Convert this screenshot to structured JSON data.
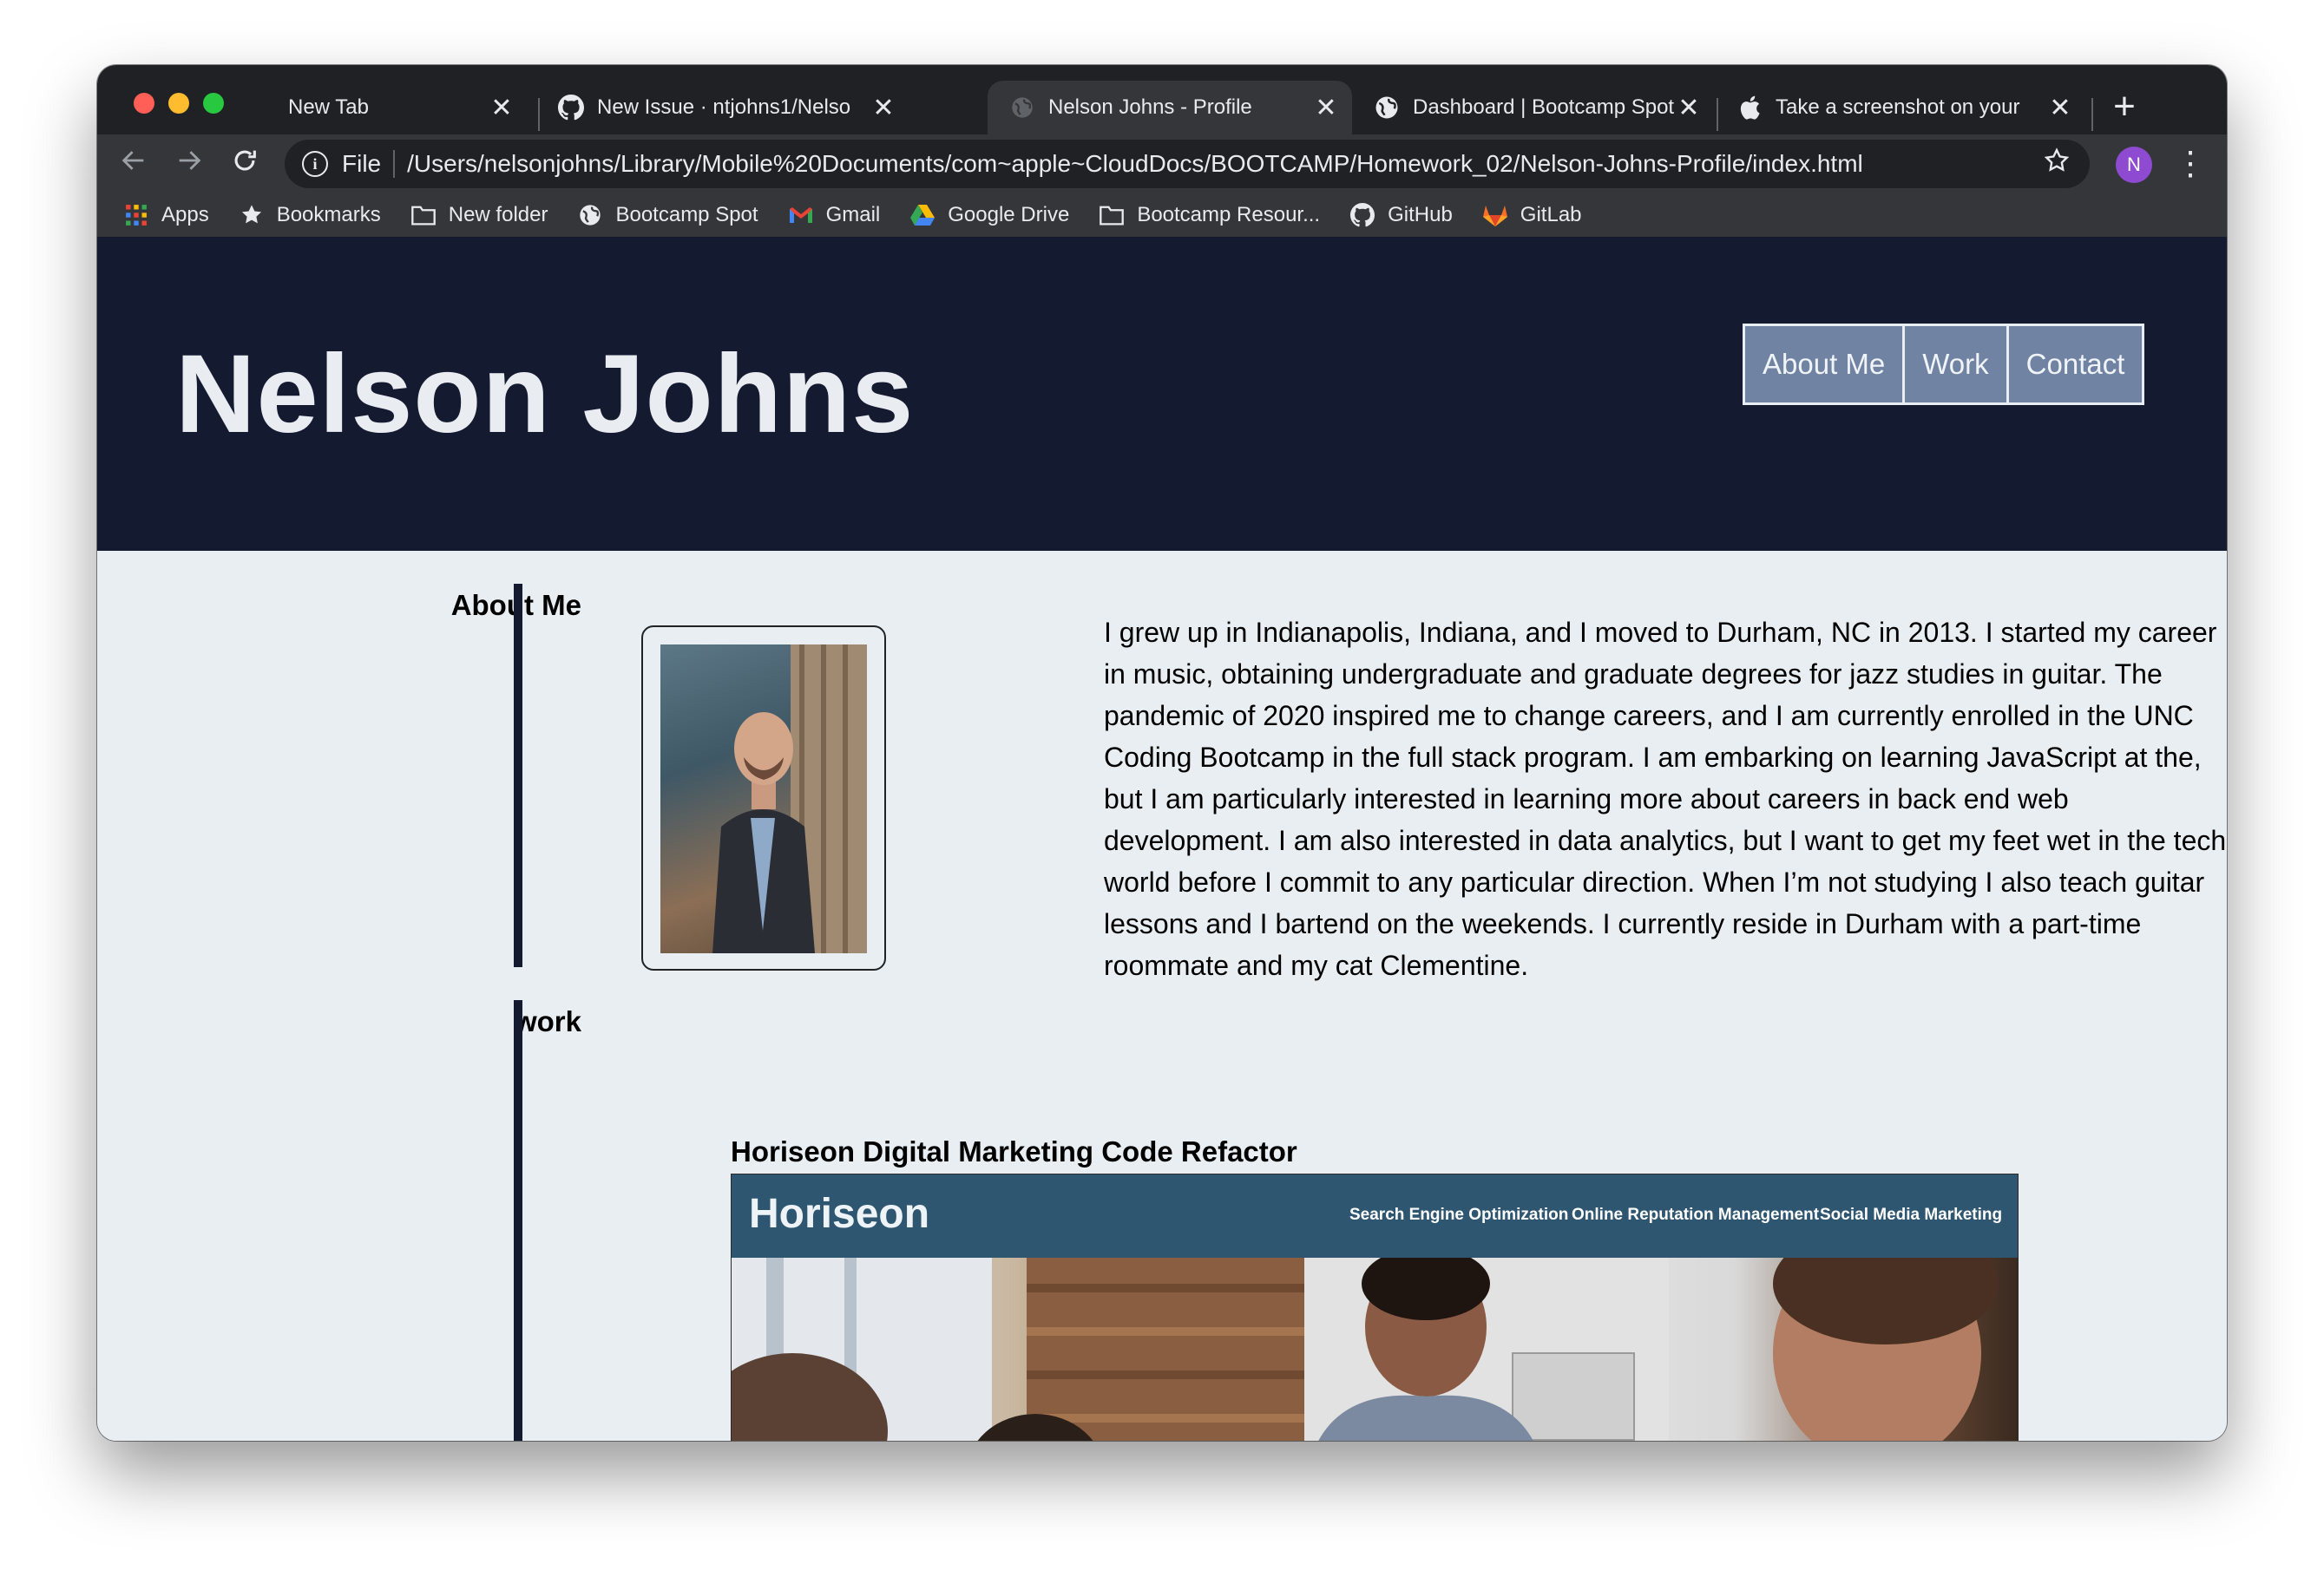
{
  "browser": {
    "tabs": [
      {
        "title": "New Tab",
        "icon": "none",
        "active": false
      },
      {
        "title": "New Issue · ntjohns1/Nelso",
        "icon": "github-icon",
        "active": false
      },
      {
        "title": "Nelson Johns - Profile",
        "icon": "globe-icon",
        "active": true
      },
      {
        "title": "Dashboard | Bootcamp Spot",
        "icon": "globe-icon",
        "active": false
      },
      {
        "title": "Take a screenshot on your",
        "icon": "apple-icon",
        "active": false
      }
    ],
    "close_glyph": "✕",
    "new_tab_glyph": "+",
    "address": {
      "scheme_label": "File",
      "url": "/Users/nelsonjohns/Library/Mobile%20Documents/com~apple~CloudDocs/BOOTCAMP/Homework_02/Nelson-Johns-Profile/index.html"
    },
    "profile_initial": "N",
    "bookmarks": [
      {
        "label": "Apps",
        "icon": "apps-grid-icon"
      },
      {
        "label": "Bookmarks",
        "icon": "star-icon"
      },
      {
        "label": "New folder",
        "icon": "folder-icon"
      },
      {
        "label": "Bootcamp Spot",
        "icon": "globe-icon"
      },
      {
        "label": "Gmail",
        "icon": "gmail-icon"
      },
      {
        "label": "Google Drive",
        "icon": "google-drive-icon"
      },
      {
        "label": "Bootcamp Resour...",
        "icon": "folder-icon"
      },
      {
        "label": "GitHub",
        "icon": "github-icon"
      },
      {
        "label": "GitLab",
        "icon": "gitlab-icon"
      }
    ]
  },
  "page": {
    "header": {
      "name": "Nelson Johns",
      "nav": [
        "About Me",
        "Work",
        "Contact"
      ]
    },
    "about": {
      "heading": "About Me",
      "text": "I grew up in Indianapolis, Indiana, and I moved to Durham, NC in 2013. I started my career in music, obtaining undergraduate and graduate degrees for jazz studies in guitar. The pandemic of 2020 inspired me to change careers, and I am currently enrolled in the UNC Coding Bootcamp in the full stack program. I am embarking on learning JavaScript at the, but I am particularly interested in learning more about careers in back end web development. I am also interested in data analytics, but I want to get my feet wet in the tech world before I commit to any particular direction. When I’m not studying I also teach guitar lessons and I bartend on the weekends. I currently reside in Durham with a part-time roommate and my cat Clementine."
    },
    "work": {
      "heading": "work",
      "project_title": "Horiseon Digital Marketing Code Refactor",
      "screenshot": {
        "logo": "Horiseon",
        "links": [
          "Search Engine Optimization",
          "Online Reputation Management",
          "Social Media Marketing"
        ]
      }
    }
  },
  "colors": {
    "header_bg": "#141b31",
    "page_bg": "#e8eef2",
    "nav_button_bg": "#7083a3",
    "horiseon_bar": "#2f5671"
  }
}
